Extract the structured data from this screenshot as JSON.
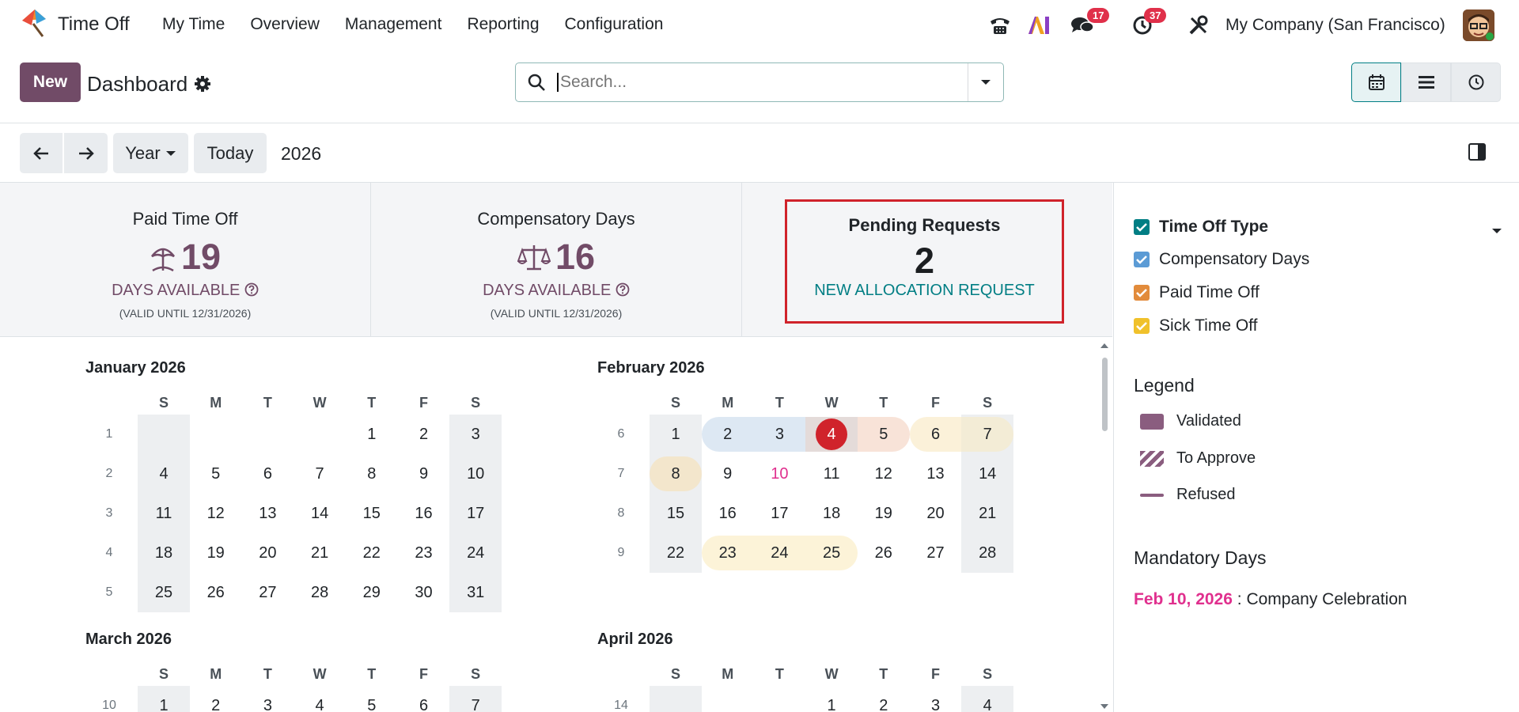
{
  "app": {
    "name": "Time Off"
  },
  "menu": [
    "My Time",
    "Overview",
    "Management",
    "Reporting",
    "Configuration"
  ],
  "systray": {
    "messages_count": "17",
    "activities_count": "37",
    "company": "My Company (San Francisco)"
  },
  "control": {
    "new_label": "New",
    "breadcrumb": "Dashboard",
    "search_placeholder": "Search..."
  },
  "calendar_controls": {
    "scale": "Year",
    "today": "Today",
    "current": "2026"
  },
  "stats": [
    {
      "title": "Paid Time Off",
      "value": "19",
      "available": "DAYS AVAILABLE",
      "valid": "(VALID UNTIL 12/31/2026)"
    },
    {
      "title": "Compensatory Days",
      "value": "16",
      "available": "DAYS AVAILABLE",
      "valid": "(VALID UNTIL 12/31/2026)"
    }
  ],
  "pending": {
    "title": "Pending Requests",
    "value": "2",
    "link": "NEW ALLOCATION REQUEST"
  },
  "weekdays": [
    "S",
    "M",
    "T",
    "W",
    "T",
    "F",
    "S"
  ],
  "months": [
    {
      "title": "January 2026",
      "weeks": [
        {
          "num": "1",
          "days": [
            "",
            "",
            "",
            "",
            "1",
            "2",
            "3"
          ]
        },
        {
          "num": "2",
          "days": [
            "4",
            "5",
            "6",
            "7",
            "8",
            "9",
            "10"
          ]
        },
        {
          "num": "3",
          "days": [
            "11",
            "12",
            "13",
            "14",
            "15",
            "16",
            "17"
          ]
        },
        {
          "num": "4",
          "days": [
            "18",
            "19",
            "20",
            "21",
            "22",
            "23",
            "24"
          ]
        },
        {
          "num": "5",
          "days": [
            "25",
            "26",
            "27",
            "28",
            "29",
            "30",
            "31"
          ]
        }
      ]
    },
    {
      "title": "February 2026",
      "weeks": [
        {
          "num": "6",
          "days": [
            "1",
            "2",
            "3",
            "4",
            "5",
            "6",
            "7"
          ]
        },
        {
          "num": "7",
          "days": [
            "8",
            "9",
            "10",
            "11",
            "12",
            "13",
            "14"
          ]
        },
        {
          "num": "8",
          "days": [
            "15",
            "16",
            "17",
            "18",
            "19",
            "20",
            "21"
          ]
        },
        {
          "num": "9",
          "days": [
            "22",
            "23",
            "24",
            "25",
            "26",
            "27",
            "28"
          ]
        }
      ]
    },
    {
      "title": "March 2026",
      "weeks": [
        {
          "num": "10",
          "days": [
            "1",
            "2",
            "3",
            "4",
            "5",
            "6",
            "7"
          ]
        }
      ]
    },
    {
      "title": "April 2026",
      "weeks": [
        {
          "num": "14",
          "days": [
            "",
            "",
            "",
            "1",
            "2",
            "3",
            "4"
          ]
        }
      ]
    }
  ],
  "side": {
    "filter_title": "Time Off Type",
    "filters": [
      {
        "label": "Compensatory Days",
        "color": "#5b9bd5"
      },
      {
        "label": "Paid Time Off",
        "color": "#e28b3b"
      },
      {
        "label": "Sick Time Off",
        "color": "#f0c12b"
      }
    ],
    "legend_title": "Legend",
    "legend": [
      "Validated",
      "To Approve",
      "Refused"
    ],
    "mandatory_title": "Mandatory Days",
    "mandatory_date": "Feb 10, 2026",
    "mandatory_sep": " : ",
    "mandatory_name": "Company Celebration"
  },
  "colors": {
    "brand": "#714b67",
    "teal": "#017e84",
    "today": "#d0232b",
    "mandatory": "#e0308e"
  }
}
